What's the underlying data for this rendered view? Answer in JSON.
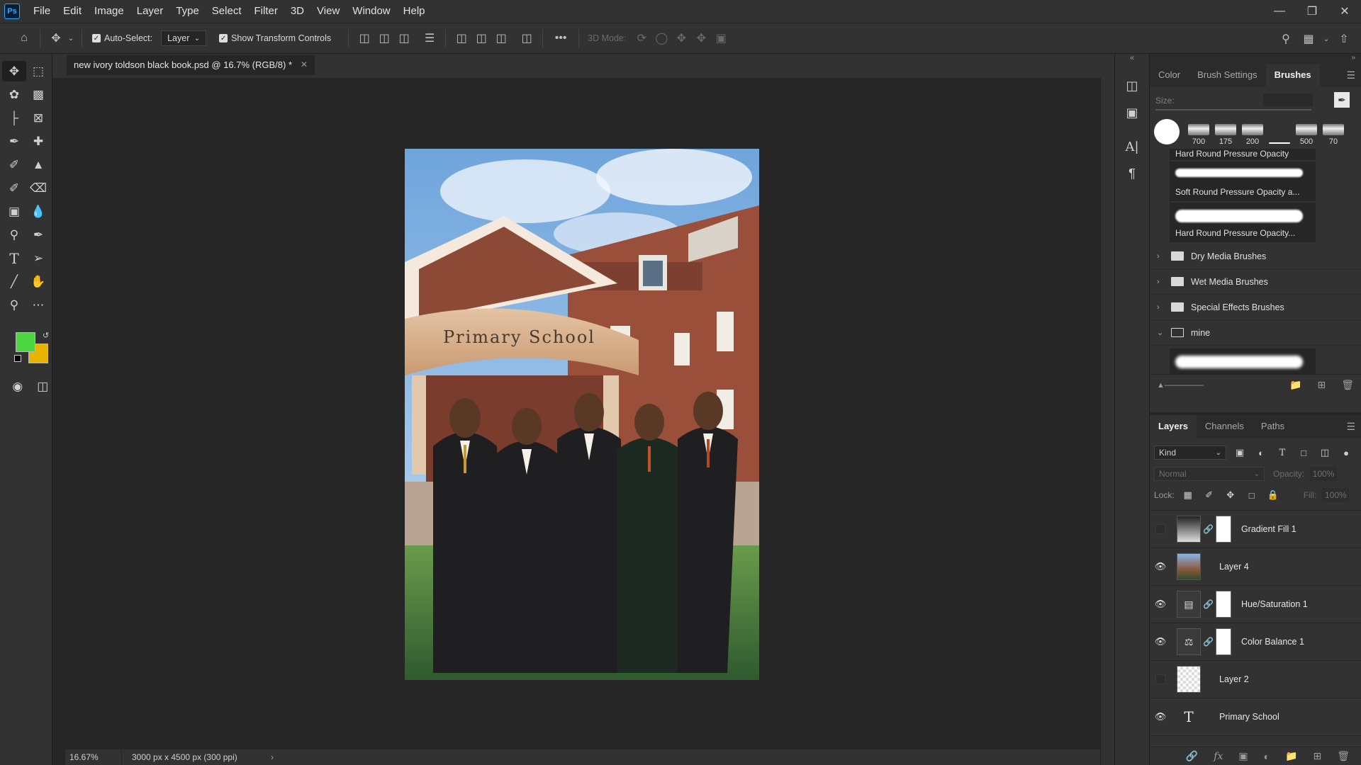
{
  "app": {
    "logo": "Ps"
  },
  "menu": [
    "File",
    "Edit",
    "Image",
    "Layer",
    "Type",
    "Select",
    "Filter",
    "3D",
    "View",
    "Window",
    "Help"
  ],
  "options": {
    "auto_select_label": "Auto-Select:",
    "auto_select_value": "Layer",
    "show_transform_label": "Show Transform Controls",
    "mode_3d_label": "3D Mode:",
    "more": "•••"
  },
  "document": {
    "tab_title": "new ivory toldson black book.psd @ 16.7% (RGB/8) *",
    "sign_text": "Primary School"
  },
  "colors": {
    "foreground": "#4cd640",
    "background": "#e8b400",
    "accent": "#31a8ff"
  },
  "status": {
    "zoom": "16.67%",
    "info": "3000 px x 4500 px (300 ppi)"
  },
  "brushes_panel": {
    "tabs": [
      "Color",
      "Brush Settings",
      "Brushes"
    ],
    "active_tab": "Brushes",
    "size_label": "Size:",
    "presets": [
      "700",
      "175",
      "200",
      "",
      "500",
      "70"
    ],
    "entries": [
      "Hard Round Pressure Opacity",
      "Soft Round Pressure Opacity a...",
      "Hard Round Pressure Opacity..."
    ],
    "folders": [
      "Dry Media Brushes",
      "Wet Media Brushes",
      "Special Effects Brushes",
      "mine"
    ]
  },
  "layers_panel": {
    "tabs": [
      "Layers",
      "Channels",
      "Paths"
    ],
    "active_tab": "Layers",
    "kind_label": "Kind",
    "blend_mode": "Normal",
    "opacity_label": "Opacity:",
    "opacity_value": "100%",
    "lock_label": "Lock:",
    "fill_label": "Fill:",
    "fill_value": "100%",
    "layers": [
      {
        "name": "Gradient Fill 1",
        "visible": false
      },
      {
        "name": "Layer 4",
        "visible": true
      },
      {
        "name": "Hue/Saturation 1",
        "visible": true
      },
      {
        "name": "Color Balance 1",
        "visible": true
      },
      {
        "name": "Layer 2",
        "visible": false
      },
      {
        "name": "Primary School",
        "visible": true
      }
    ]
  }
}
